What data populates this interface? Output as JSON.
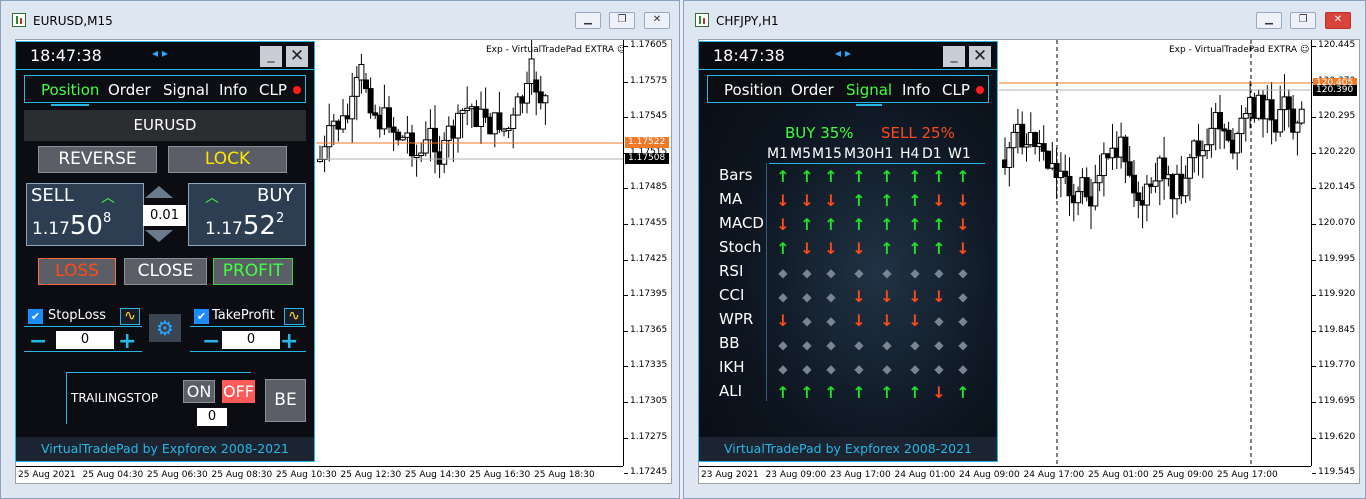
{
  "window1": {
    "title": "EURUSD,M15",
    "expert_label": "Exp - VirtualTradePad EXTRA ☺",
    "price_scale": [
      "1.17605",
      "1.17575",
      "1.17545",
      "1.17515",
      "1.17485",
      "1.17455",
      "1.17425",
      "1.17395",
      "1.17365",
      "1.17335",
      "1.17305",
      "1.17275",
      "1.17245"
    ],
    "bid_tag": "1.17522",
    "ask_tag": "1.17508",
    "time_scale": [
      "25 Aug 2021",
      "25 Aug 04:30",
      "25 Aug 06:30",
      "25 Aug 08:30",
      "25 Aug 10:30",
      "25 Aug 12:30",
      "25 Aug 14:30",
      "25 Aug 16:30",
      "25 Aug 18:30"
    ],
    "panel": {
      "clock": "18:47:38",
      "nav_arrows": "◂ ▸",
      "tabs": [
        "Position",
        "Order",
        "Signal",
        "Info",
        "CLP"
      ],
      "active_tab": "Position",
      "symbol": "EURUSD",
      "reverse_label": "REVERSE",
      "lock_label": "LOCK",
      "sell_label": "SELL",
      "buy_label": "BUY",
      "sell_price": {
        "prefix": "1.17",
        "big": "50",
        "sup": "8"
      },
      "buy_price": {
        "prefix": "1.17",
        "big": "52",
        "sup": "2"
      },
      "lot": "0.01",
      "loss_label": "LOSS",
      "close_label": "CLOSE",
      "profit_label": "PROFIT",
      "stoploss_label": "StopLoss",
      "stoploss_value": "0",
      "takeprofit_label": "TakeProfit",
      "takeprofit_value": "0",
      "trailing_label": "TRAILINGSTOP",
      "on_label": "ON",
      "off_label": "OFF",
      "trailing_value": "0",
      "be_label": "BE",
      "footer": "VirtualTradePad by Expforex 2008-2021"
    }
  },
  "window2": {
    "title": "CHFJPY,H1",
    "expert_label": "Exp - VirtualTradePad EXTRA ☺",
    "price_scale": [
      "120.445",
      "120.370",
      "120.295",
      "120.220",
      "120.145",
      "120.070",
      "119.995",
      "119.920",
      "119.845",
      "119.770",
      "119.695",
      "119.620",
      "119.545"
    ],
    "bid_tag": "120.405",
    "ask_tag": "120.390",
    "time_scale": [
      "23 Aug 2021",
      "23 Aug 09:00",
      "23 Aug 17:00",
      "24 Aug 01:00",
      "24 Aug 09:00",
      "24 Aug 17:00",
      "25 Aug 01:00",
      "25 Aug 09:00",
      "25 Aug 17:00"
    ],
    "panel": {
      "clock": "18:47:38",
      "nav_arrows": "◂ ▸",
      "tabs": [
        "Position",
        "Order",
        "Signal",
        "Info",
        "CLP"
      ],
      "active_tab": "Signal",
      "buy_pct": "BUY 35%",
      "sell_pct": "SELL 25%",
      "timeframes": [
        "M1",
        "M5",
        "M15",
        "M30",
        "H1",
        "H4",
        "D1",
        "W1"
      ],
      "indicators": [
        "Bars",
        "MA",
        "MACD",
        "Stoch",
        "RSI",
        "CCI",
        "WPR",
        "BB",
        "IKH",
        "ALI"
      ],
      "signals": [
        [
          "u",
          "u",
          "u",
          "u",
          "u",
          "u",
          "u",
          "u"
        ],
        [
          "d",
          "d",
          "d",
          "u",
          "u",
          "u",
          "d",
          "d"
        ],
        [
          "d",
          "u",
          "u",
          "u",
          "u",
          "u",
          "u",
          "d"
        ],
        [
          "u",
          "d",
          "d",
          "d",
          "u",
          "u",
          "u",
          "d"
        ],
        [
          "n",
          "n",
          "n",
          "n",
          "n",
          "n",
          "n",
          "n"
        ],
        [
          "n",
          "n",
          "n",
          "d",
          "d",
          "d",
          "d",
          "n"
        ],
        [
          "d",
          "n",
          "n",
          "d",
          "d",
          "d",
          "n",
          "n"
        ],
        [
          "n",
          "n",
          "n",
          "n",
          "n",
          "n",
          "n",
          "n"
        ],
        [
          "n",
          "n",
          "n",
          "n",
          "n",
          "n",
          "n",
          "n"
        ],
        [
          "u",
          "u",
          "u",
          "u",
          "u",
          "u",
          "d",
          "u"
        ]
      ],
      "footer": "VirtualTradePad by Expforex 2008-2021"
    }
  },
  "colors": {
    "up": "#22e02a",
    "down": "#ff4a1a",
    "accent": "#26b7e6",
    "bid": "#f07a2a"
  }
}
